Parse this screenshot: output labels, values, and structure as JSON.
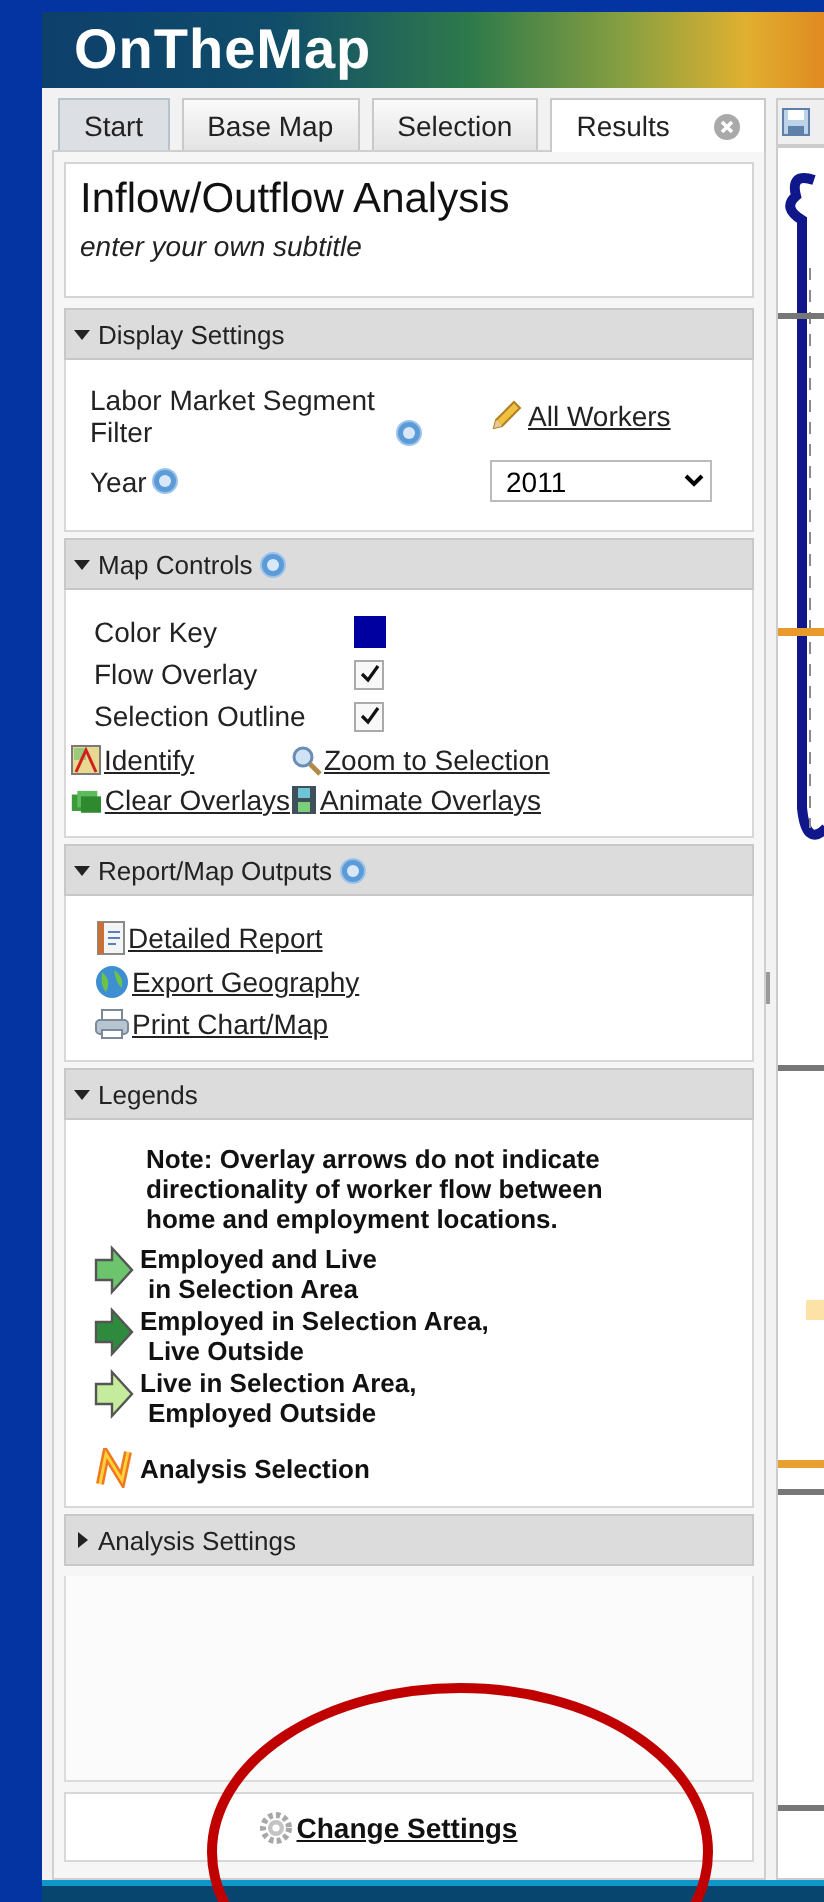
{
  "app_title": "OnTheMap",
  "tabs": [
    {
      "label": "Start",
      "selected": false,
      "closable": false
    },
    {
      "label": "Base Map",
      "selected": false,
      "closable": false
    },
    {
      "label": "Selection",
      "selected": false,
      "closable": false
    },
    {
      "label": "Results",
      "selected": true,
      "closable": true
    }
  ],
  "title": "Inflow/Outflow Analysis",
  "subtitle": "enter your own subtitle",
  "sections": [
    {
      "kind": "display",
      "title": "Display Settings",
      "expanded": true,
      "help": false,
      "segment_label": "Labor Market Segment Filter",
      "segment_value": "All Workers",
      "year_label": "Year",
      "year_value": "2011"
    },
    {
      "kind": "controls",
      "title": "Map Controls",
      "expanded": true,
      "help": true,
      "color_key": {
        "label": "Color Key",
        "color": "#0000a0"
      },
      "toggles": [
        {
          "label": "Flow Overlay",
          "checked": true
        },
        {
          "label": "Selection Outline",
          "checked": true
        }
      ],
      "links": [
        {
          "kind": "identify",
          "label": "Identify"
        },
        {
          "kind": "zoom",
          "label": "Zoom to Selection"
        },
        {
          "kind": "clear",
          "label": "Clear Overlays"
        },
        {
          "kind": "animate",
          "label": "Animate Overlays"
        }
      ]
    },
    {
      "kind": "outputs",
      "title": "Report/Map Outputs",
      "expanded": true,
      "help": true,
      "links": [
        {
          "kind": "report",
          "label": "Detailed Report"
        },
        {
          "kind": "export",
          "label": "Export Geography"
        },
        {
          "kind": "print",
          "label": "Print Chart/Map"
        }
      ]
    },
    {
      "kind": "legend",
      "title": "Legends",
      "expanded": true,
      "help": false,
      "note": "Note: Overlay arrows do not indicate directionality of worker flow between home and employment locations.",
      "items": [
        {
          "kind": "arrow",
          "color": "#6cc46c",
          "lines": [
            "Employed and Live",
            "in Selection Area"
          ]
        },
        {
          "kind": "arrow",
          "color": "#2e8b3e",
          "lines": [
            "Employed in Selection Area,",
            "Live Outside"
          ]
        },
        {
          "kind": "arrow",
          "color": "#c4ec9c",
          "lines": [
            "Live in Selection Area,",
            "Employed Outside"
          ]
        },
        {
          "kind": "selection",
          "lines": [
            "Analysis Selection"
          ]
        }
      ]
    },
    {
      "kind": "settings",
      "title": "Analysis Settings",
      "expanded": false,
      "help": false
    }
  ],
  "footer_link": "Change Settings"
}
